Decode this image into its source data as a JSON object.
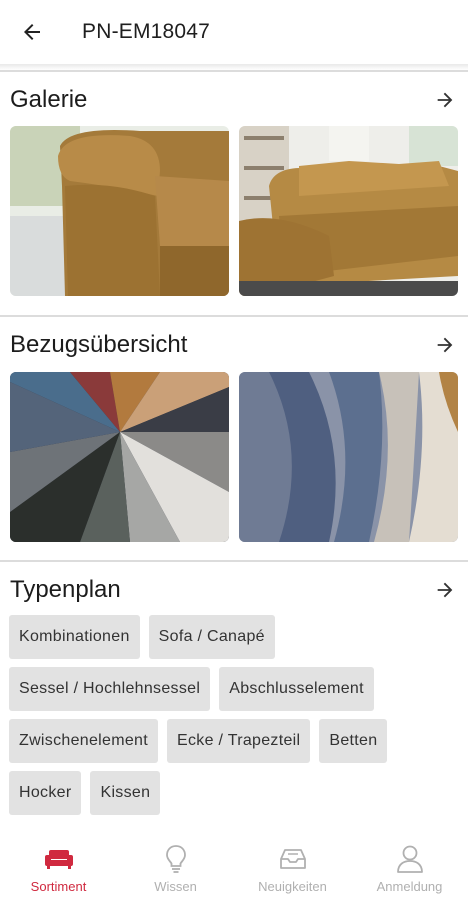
{
  "header": {
    "title": "PN-EM18047"
  },
  "sections": {
    "galerie": {
      "title": "Galerie"
    },
    "bezug": {
      "title": "Bezugsübersicht"
    },
    "typenplan": {
      "title": "Typenplan"
    }
  },
  "chips": [
    [
      "Kombinationen",
      "Sofa / Canapé"
    ],
    [
      "Sessel / Hochlehnsessel",
      "Abschlusselement"
    ],
    [
      "Zwischenelement",
      "Ecke / Trapezteil",
      "Betten"
    ],
    [
      "Hocker",
      "Kissen"
    ]
  ],
  "nav": [
    {
      "label": "Sortiment",
      "icon": "sofa-icon",
      "active": true
    },
    {
      "label": "Wissen",
      "icon": "lightbulb-icon",
      "active": false
    },
    {
      "label": "Neuigkeiten",
      "icon": "inbox-icon",
      "active": false
    },
    {
      "label": "Anmeldung",
      "icon": "user-icon",
      "active": false
    }
  ],
  "colors": {
    "accent": "#d0293f",
    "chip_bg": "#e2e2e2",
    "nav_inactive": "#b0b0b0"
  }
}
